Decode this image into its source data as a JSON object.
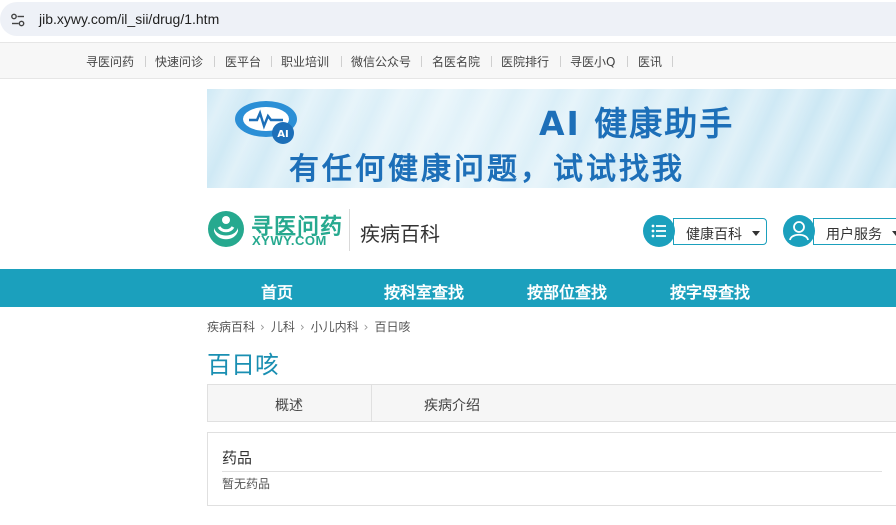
{
  "browser": {
    "url": "jib.xywy.com/il_sii/drug/1.htm",
    "site_info_icon": "tune-icon"
  },
  "topnav": {
    "items": [
      "寻医问药",
      "快速问诊",
      "医平台",
      "职业培训",
      "微信公众号",
      "名医名院",
      "医院排行",
      "寻医小Q",
      "医讯"
    ]
  },
  "banner": {
    "line1": "AI 健康助手",
    "line2": "有任何健康问题，试试找我",
    "logo_icon": "ai-assistant-icon",
    "logo_text": "AI"
  },
  "header": {
    "logo_cn": "寻医问药",
    "logo_en": "XYWY.COM",
    "section": "疾病百科",
    "wiki_button": "健康百科",
    "wiki_icon": "list-icon",
    "user_button": "用户服务",
    "user_icon": "user-icon"
  },
  "mainnav": {
    "items": [
      "首页",
      "按科室查找",
      "按部位查找",
      "按字母查找"
    ]
  },
  "breadcrumb": [
    "疾病百科",
    "儿科",
    "小儿内科",
    "百日咳"
  ],
  "page": {
    "title": "百日咳"
  },
  "tabs": [
    "概述",
    "疾病介绍"
  ],
  "drugs": {
    "title": "药品",
    "empty_text": "暂无药品"
  },
  "colors": {
    "brand_teal": "#1ba0bd",
    "logo_green": "#26a98f",
    "title_blue": "#1a8fb2",
    "banner_text": "#1d6fb8"
  }
}
